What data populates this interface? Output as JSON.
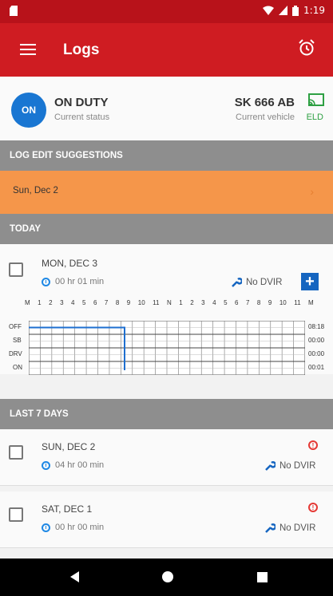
{
  "statusbar": {
    "time": "1:19"
  },
  "appbar": {
    "title": "Logs"
  },
  "status": {
    "badge": "ON",
    "duty": "ON DUTY",
    "duty_sub": "Current status",
    "vehicle": "SK 666 AB",
    "vehicle_sub": "Current vehicle",
    "eld": "ELD"
  },
  "sections": {
    "suggestions": "LOG EDIT SUGGESTIONS",
    "today": "TODAY",
    "last7": "LAST 7 DAYS"
  },
  "suggestion_item": {
    "label": "Sun, Dec 2"
  },
  "today": {
    "day": "MON, DEC 3",
    "duration": "00 hr  01 min",
    "dvir": "No DVIR",
    "plus": "+",
    "hours": [
      "M",
      "1",
      "2",
      "3",
      "4",
      "5",
      "6",
      "7",
      "8",
      "9",
      "10",
      "11",
      "N",
      "1",
      "2",
      "3",
      "4",
      "5",
      "6",
      "7",
      "8",
      "9",
      "10",
      "11",
      "M"
    ],
    "rows": [
      "OFF",
      "SB",
      "DRV",
      "ON"
    ],
    "totals": [
      "08:18",
      "00:00",
      "00:00",
      "00:01"
    ]
  },
  "last7": [
    {
      "day": "SUN, DEC 2",
      "duration": "04 hr  00 min",
      "dvir": "No DVIR",
      "warn": "!"
    },
    {
      "day": "SAT, DEC 1",
      "duration": "00 hr  00 min",
      "dvir": "No DVIR",
      "warn": "!"
    }
  ],
  "colors": {
    "primary": "#cf1c22",
    "accent": "#1976d2",
    "suggestion": "#f5964a"
  }
}
